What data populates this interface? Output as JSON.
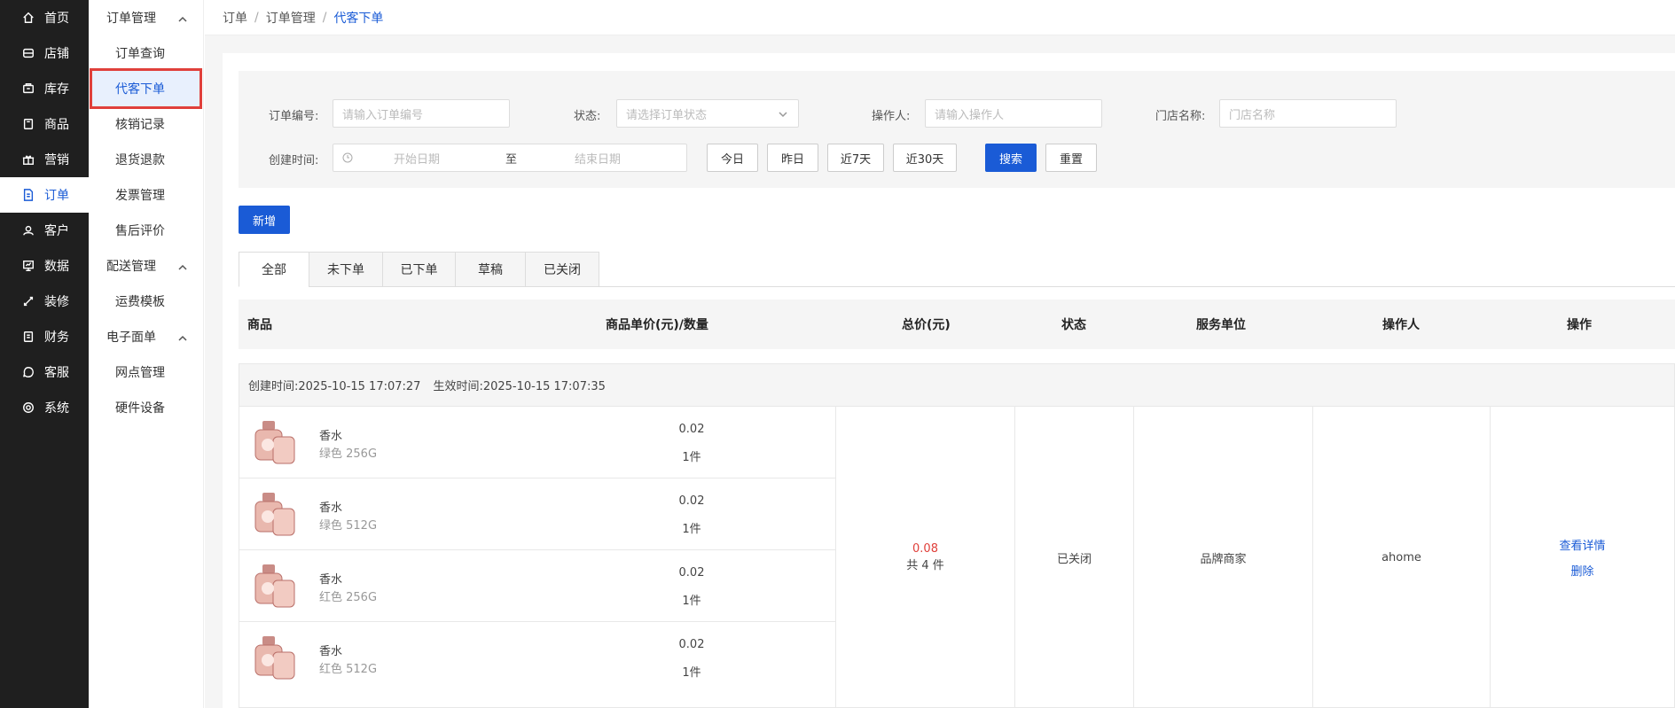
{
  "rail": [
    {
      "label": "首页",
      "icon": "home-icon"
    },
    {
      "label": "店铺",
      "icon": "store-icon"
    },
    {
      "label": "库存",
      "icon": "inventory-icon"
    },
    {
      "label": "商品",
      "icon": "goods-icon"
    },
    {
      "label": "营销",
      "icon": "gift-icon"
    },
    {
      "label": "订单",
      "icon": "order-icon",
      "active": true
    },
    {
      "label": "客户",
      "icon": "customer-icon"
    },
    {
      "label": "数据",
      "icon": "data-icon"
    },
    {
      "label": "装修",
      "icon": "decorate-icon"
    },
    {
      "label": "财务",
      "icon": "finance-icon"
    },
    {
      "label": "客服",
      "icon": "chat-icon"
    },
    {
      "label": "系统",
      "icon": "settings-icon"
    }
  ],
  "submenu": {
    "group1": "订单管理",
    "items1": [
      "订单查询",
      "代客下单",
      "核销记录",
      "退货退款",
      "发票管理",
      "售后评价"
    ],
    "group2": "配送管理",
    "items2": [
      "运费模板"
    ],
    "group3": "电子面单",
    "items3": [
      "网点管理",
      "硬件设备"
    ]
  },
  "breadcrumb": [
    "订单",
    "订单管理",
    "代客下单"
  ],
  "filter": {
    "order_no_label": "订单编号:",
    "order_no_placeholder": "请输入订单编号",
    "status_label": "状态:",
    "status_placeholder": "请选择订单状态",
    "operator_label": "操作人:",
    "operator_placeholder": "请输入操作人",
    "store_label": "门店名称:",
    "store_placeholder": "门店名称",
    "created_label": "创建时间:",
    "start_placeholder": "开始日期",
    "range_sep": "至",
    "end_placeholder": "结束日期",
    "quick": [
      "今日",
      "昨日",
      "近7天",
      "近30天"
    ],
    "search": "搜索",
    "reset": "重置"
  },
  "add_button": "新增",
  "tabs": [
    "全部",
    "未下单",
    "已下单",
    "草稿",
    "已关闭"
  ],
  "table": {
    "headers": [
      "商品",
      "商品单价(元)/数量",
      "总价(元)",
      "状态",
      "服务单位",
      "操作人",
      "操作"
    ]
  },
  "order": {
    "created": "创建时间:2025-10-15 17:07:27",
    "effective": "生效时间:2025-10-15 17:07:35",
    "products": [
      {
        "name": "香水",
        "spec": "绿色 256G",
        "price": "0.02",
        "qty": "1件"
      },
      {
        "name": "香水",
        "spec": "绿色 512G",
        "price": "0.02",
        "qty": "1件"
      },
      {
        "name": "香水",
        "spec": "红色 256G",
        "price": "0.02",
        "qty": "1件"
      },
      {
        "name": "香水",
        "spec": "红色 512G",
        "price": "0.02",
        "qty": "1件"
      }
    ],
    "total": "0.08",
    "total_count": "共 4 件",
    "status": "已关闭",
    "service_unit": "品牌商家",
    "operator": "ahome",
    "actions": [
      "查看详情",
      "删除"
    ]
  },
  "colors": {
    "primary": "#1a5bd6",
    "rail_bg": "#1f1f1f",
    "highlight": "#e0403b",
    "price": "#e0403b"
  }
}
